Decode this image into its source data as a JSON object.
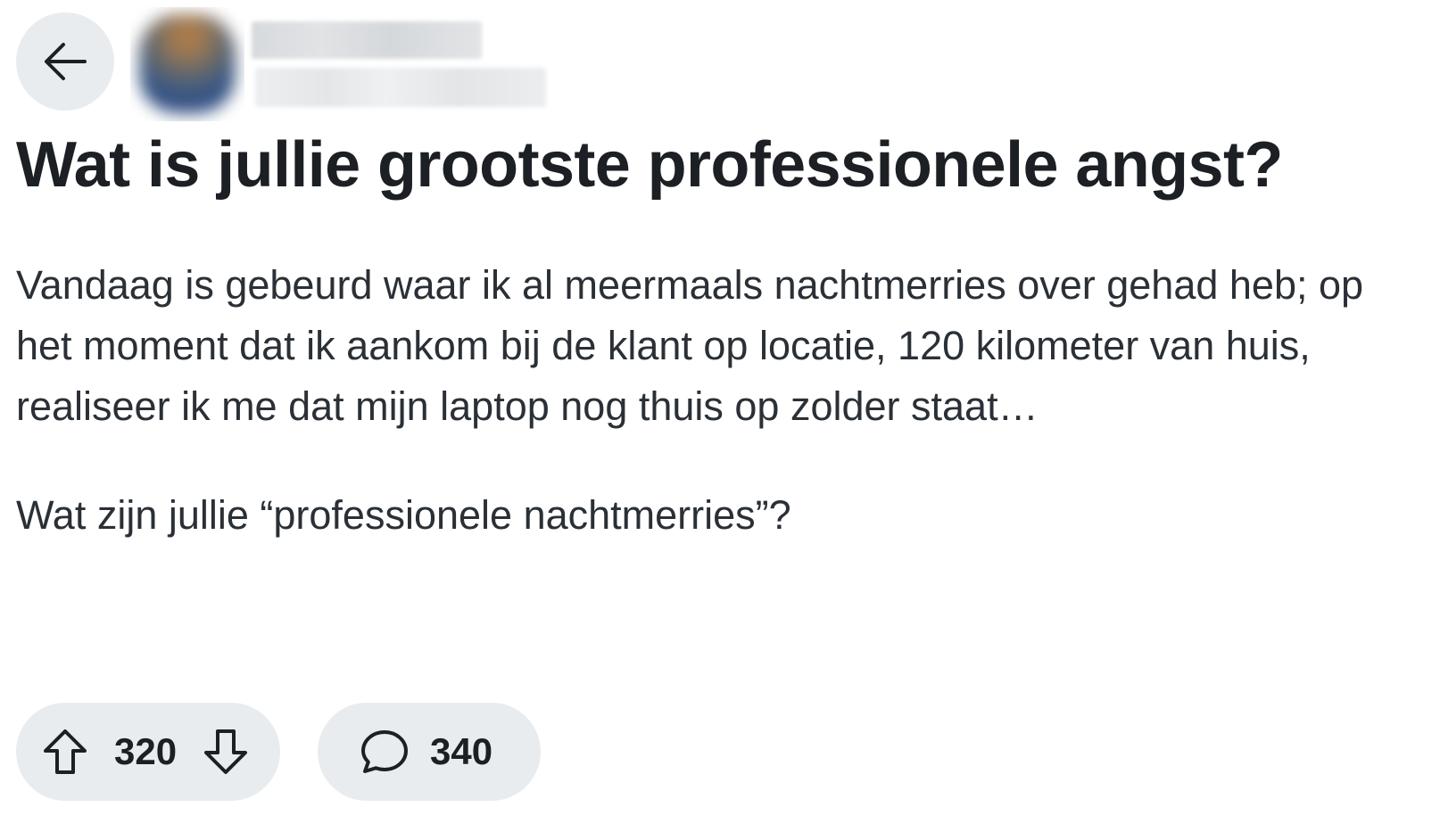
{
  "header": {
    "back_icon": "arrow-left-icon",
    "avatar_blurred": true,
    "author_blurred": true
  },
  "post": {
    "title": "Wat is jullie grootste professionele angst?",
    "body_paragraph_1": "Vandaag is gebeurd waar ik al meermaals nachtmerries over gehad heb; op het moment dat ik aankom bij de klant op locatie, 120 kilometer van huis, realiseer ik me dat mijn laptop nog thuis op zolder staat…",
    "body_paragraph_2": "Wat zijn jullie “professionele nachtmerries”?"
  },
  "actions": {
    "upvote_icon": "arrow-up-outline-icon",
    "vote_count": "320",
    "downvote_icon": "arrow-down-outline-icon",
    "comment_icon": "speech-bubble-icon",
    "comment_count": "340"
  },
  "colors": {
    "pill_background": "#e8ecef",
    "title_text": "#1c1f23",
    "body_text": "#2a3036"
  }
}
